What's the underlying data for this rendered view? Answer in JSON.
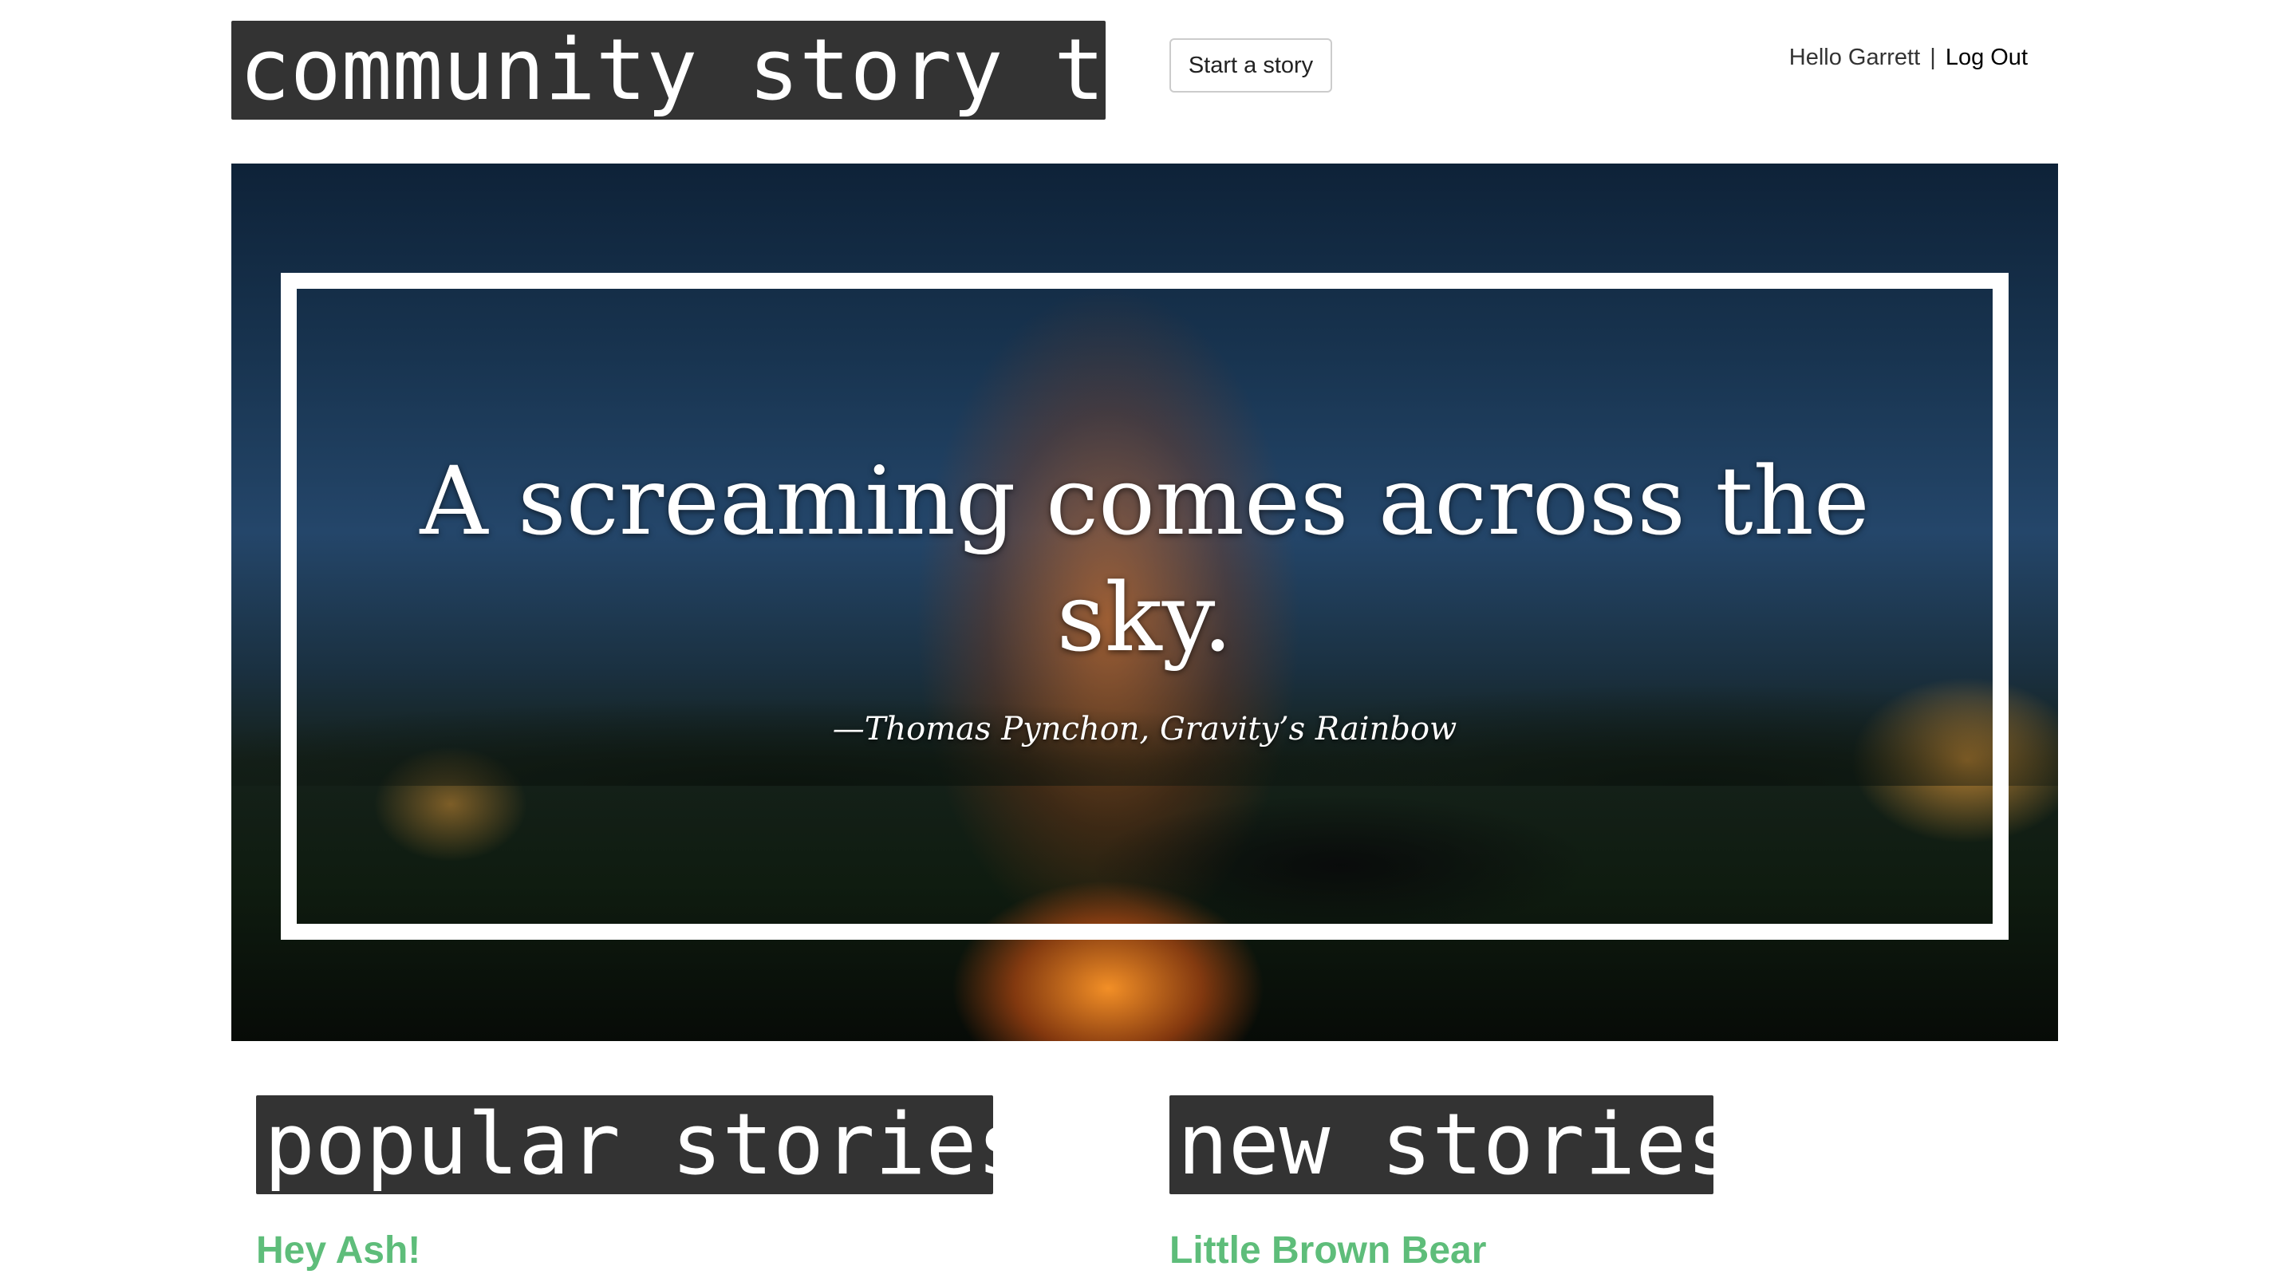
{
  "header": {
    "logo": "community story time",
    "start_button": "Start a story",
    "greeting": "Hello Garrett",
    "separator": "|",
    "logout": "Log Out"
  },
  "hero": {
    "quote": "A screaming comes across the sky.",
    "attribution": "—Thomas Pynchon, Gravity’s Rainbow"
  },
  "sections": {
    "popular": {
      "heading": "popular stories",
      "stories": [
        "Hey Ash!"
      ]
    },
    "new": {
      "heading": "new stories",
      "stories": [
        "Little Brown Bear"
      ]
    }
  },
  "colors": {
    "heading_bg": "#333333",
    "story_link": "#5ebd7a"
  }
}
